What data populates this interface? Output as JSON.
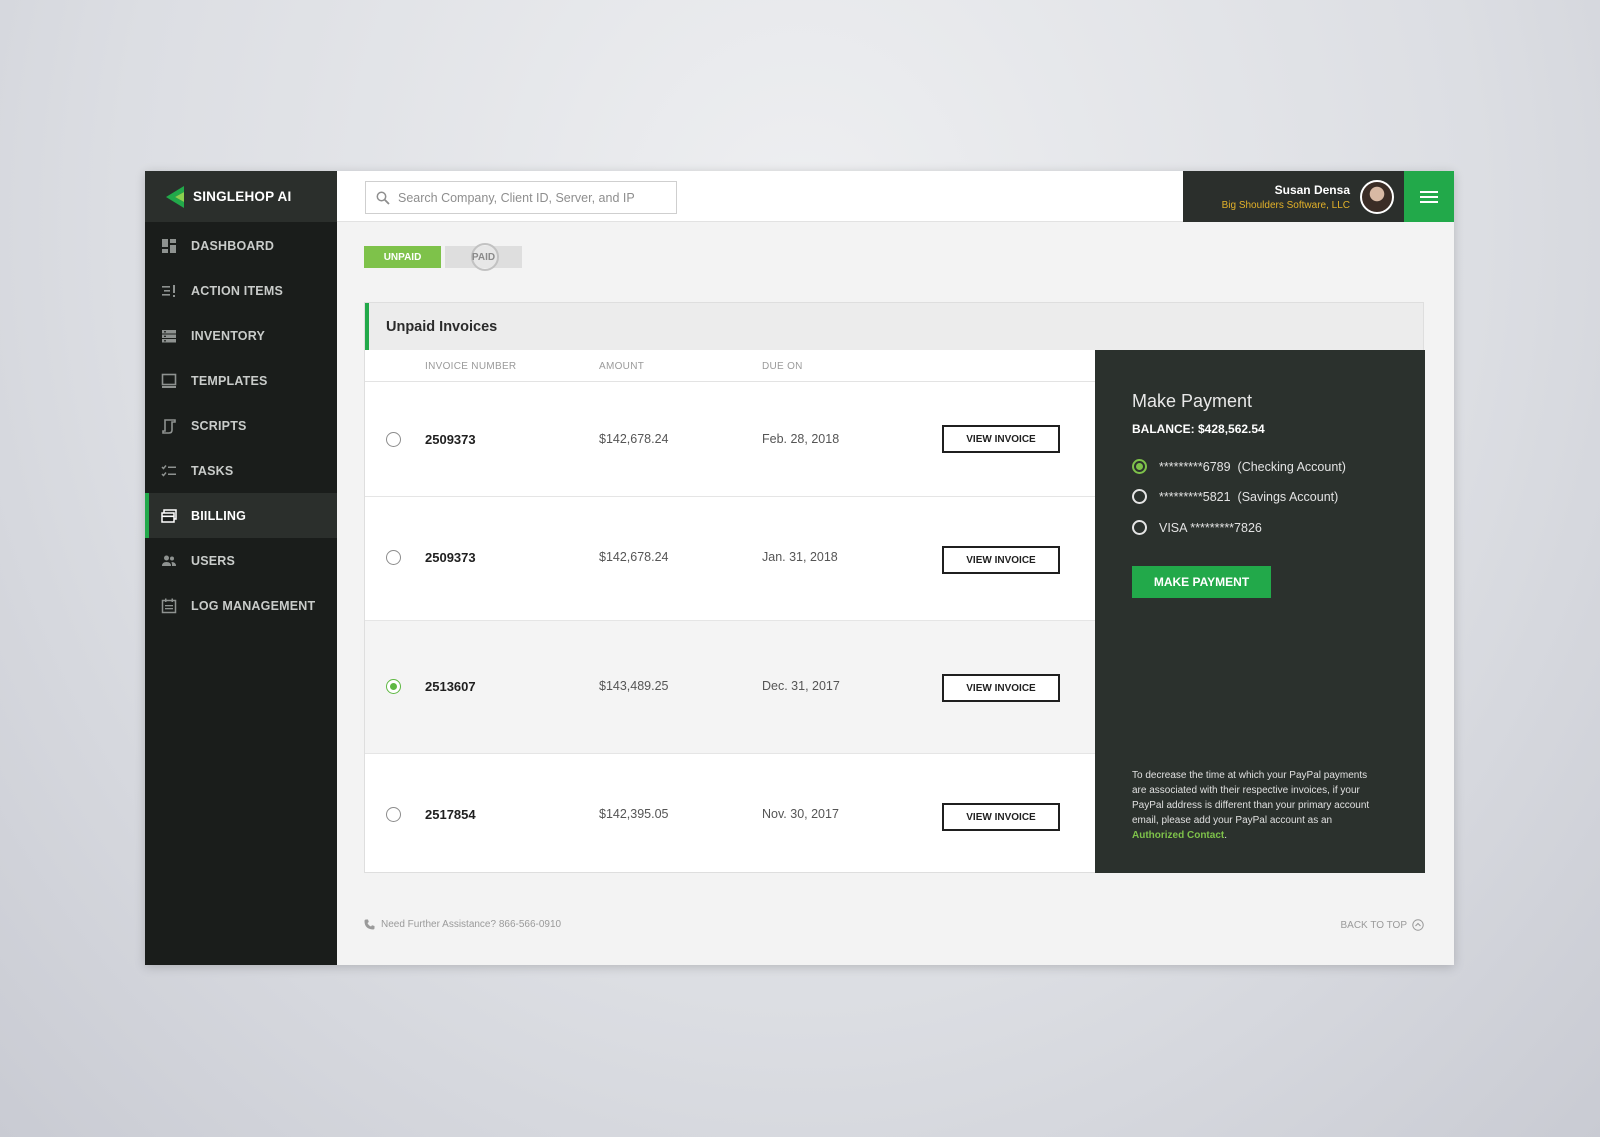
{
  "brand": {
    "name": "SINGLEHOP AI"
  },
  "colors": {
    "accent": "#22a94a",
    "accent_light": "#7ec24a",
    "sidebar": "#1a1d1b",
    "panel_dark": "#2b312d",
    "company": "#e3b129"
  },
  "sidebar": {
    "items": [
      {
        "label": "DASHBOARD",
        "icon": "dashboard-icon"
      },
      {
        "label": "ACTION ITEMS",
        "icon": "action-items-icon"
      },
      {
        "label": "INVENTORY",
        "icon": "inventory-icon"
      },
      {
        "label": "TEMPLATES",
        "icon": "templates-icon"
      },
      {
        "label": "SCRIPTS",
        "icon": "scripts-icon"
      },
      {
        "label": "TASKS",
        "icon": "tasks-icon"
      },
      {
        "label": "BIILLING",
        "icon": "billing-icon",
        "active": true
      },
      {
        "label": "USERS",
        "icon": "users-icon"
      },
      {
        "label": "LOG MANAGEMENT",
        "icon": "log-management-icon"
      }
    ]
  },
  "search": {
    "placeholder": "Search Company, Client ID, Server, and IP",
    "value": ""
  },
  "user": {
    "name": "Susan Densa",
    "company": "Big Shoulders Software, LLC"
  },
  "toggles": {
    "unpaid": "UNPAID",
    "paid": "PAID",
    "selected": "unpaid"
  },
  "invoices": {
    "title": "Unpaid Invoices",
    "columns": [
      "INVOICE NUMBER",
      "AMOUNT",
      "DUE ON"
    ],
    "button_label": "VIEW INVOICE",
    "rows": [
      {
        "number": "2509373",
        "amount": "$142,678.24",
        "due": "Feb. 28, 2018",
        "selected": false
      },
      {
        "number": "2509373",
        "amount": "$142,678.24",
        "due": "Jan. 31, 2018",
        "selected": false
      },
      {
        "number": "2513607",
        "amount": "$143,489.25",
        "due": "Dec. 31, 2017",
        "selected": true
      },
      {
        "number": "2517854",
        "amount": "$142,395.05",
        "due": "Nov. 30, 2017",
        "selected": false
      }
    ]
  },
  "payment": {
    "title": "Make Payment",
    "balance": "BALANCE: $428,562.54",
    "options": [
      {
        "label": "*********6789  (Checking Account)",
        "checked": true
      },
      {
        "label": "*********5821  (Savings Account)",
        "checked": false
      },
      {
        "label": "VISA *********7826",
        "checked": false
      }
    ],
    "button": "MAKE PAYMENT",
    "note": "To decrease the time at which your PayPal payments are associated with their respective invoices, if your PayPal address is different than your primary account email, please add your PayPal account as an ",
    "note_link": "Authorized Contact",
    "note_end": "."
  },
  "footer": {
    "help": "Need Further Assistance? 866-566-0910",
    "back_to_top": "BACK TO TOP"
  }
}
